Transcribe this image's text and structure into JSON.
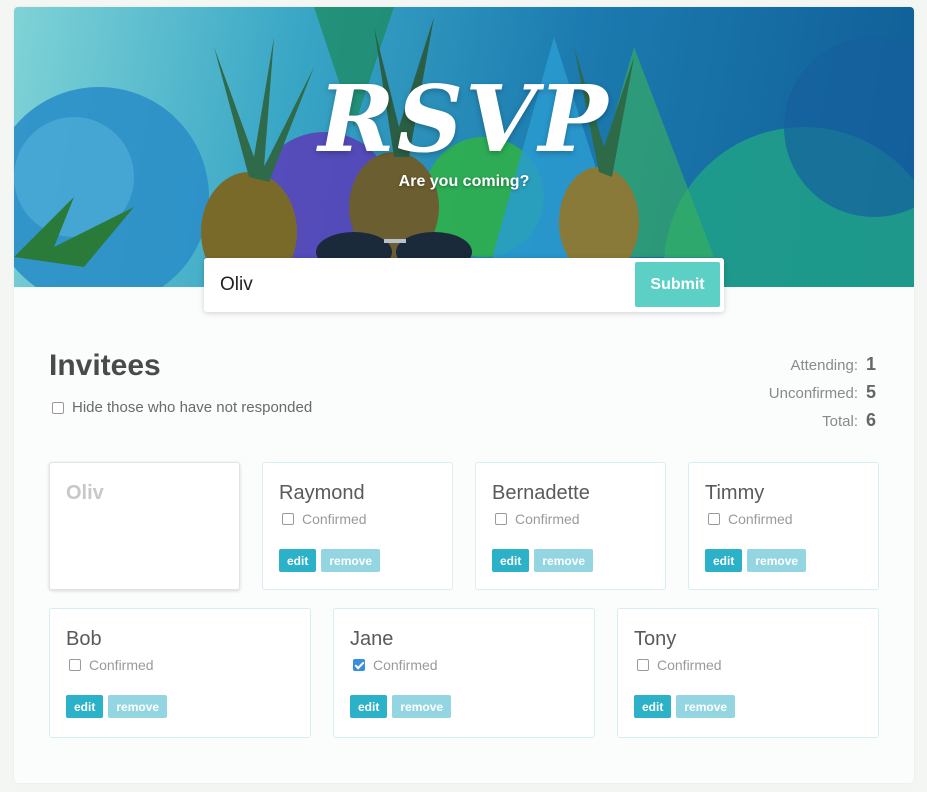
{
  "header": {
    "title": "RSVP",
    "subtitle": "Are you coming?"
  },
  "form": {
    "input_value": "Oliv",
    "submit_label": "Submit"
  },
  "invitees": {
    "heading": "Invitees",
    "hide_label": "Hide those who have not responded",
    "hide_checked": false
  },
  "counts": {
    "attending_label": "Attending:",
    "attending": "1",
    "unconfirmed_label": "Unconfirmed:",
    "unconfirmed": "5",
    "total_label": "Total:",
    "total": "6"
  },
  "pending_guest": {
    "name": "Oliv"
  },
  "guests": [
    {
      "name": "Raymond",
      "confirmed_label": "Confirmed",
      "confirmed": false,
      "edit_label": "edit",
      "remove_label": "remove"
    },
    {
      "name": "Bernadette",
      "confirmed_label": "Confirmed",
      "confirmed": false,
      "edit_label": "edit",
      "remove_label": "remove"
    },
    {
      "name": "Timmy",
      "confirmed_label": "Confirmed",
      "confirmed": false,
      "edit_label": "edit",
      "remove_label": "remove"
    },
    {
      "name": "Bob",
      "confirmed_label": "Confirmed",
      "confirmed": false,
      "edit_label": "edit",
      "remove_label": "remove"
    },
    {
      "name": "Jane",
      "confirmed_label": "Confirmed",
      "confirmed": true,
      "edit_label": "edit",
      "remove_label": "remove"
    },
    {
      "name": "Tony",
      "confirmed_label": "Confirmed",
      "confirmed": false,
      "edit_label": "edit",
      "remove_label": "remove"
    }
  ],
  "colors": {
    "accent": "#2bb2c8",
    "submit": "#5dd0c6",
    "remove": "#93d6e2",
    "checkbox_checked": "#3b8ddd"
  }
}
